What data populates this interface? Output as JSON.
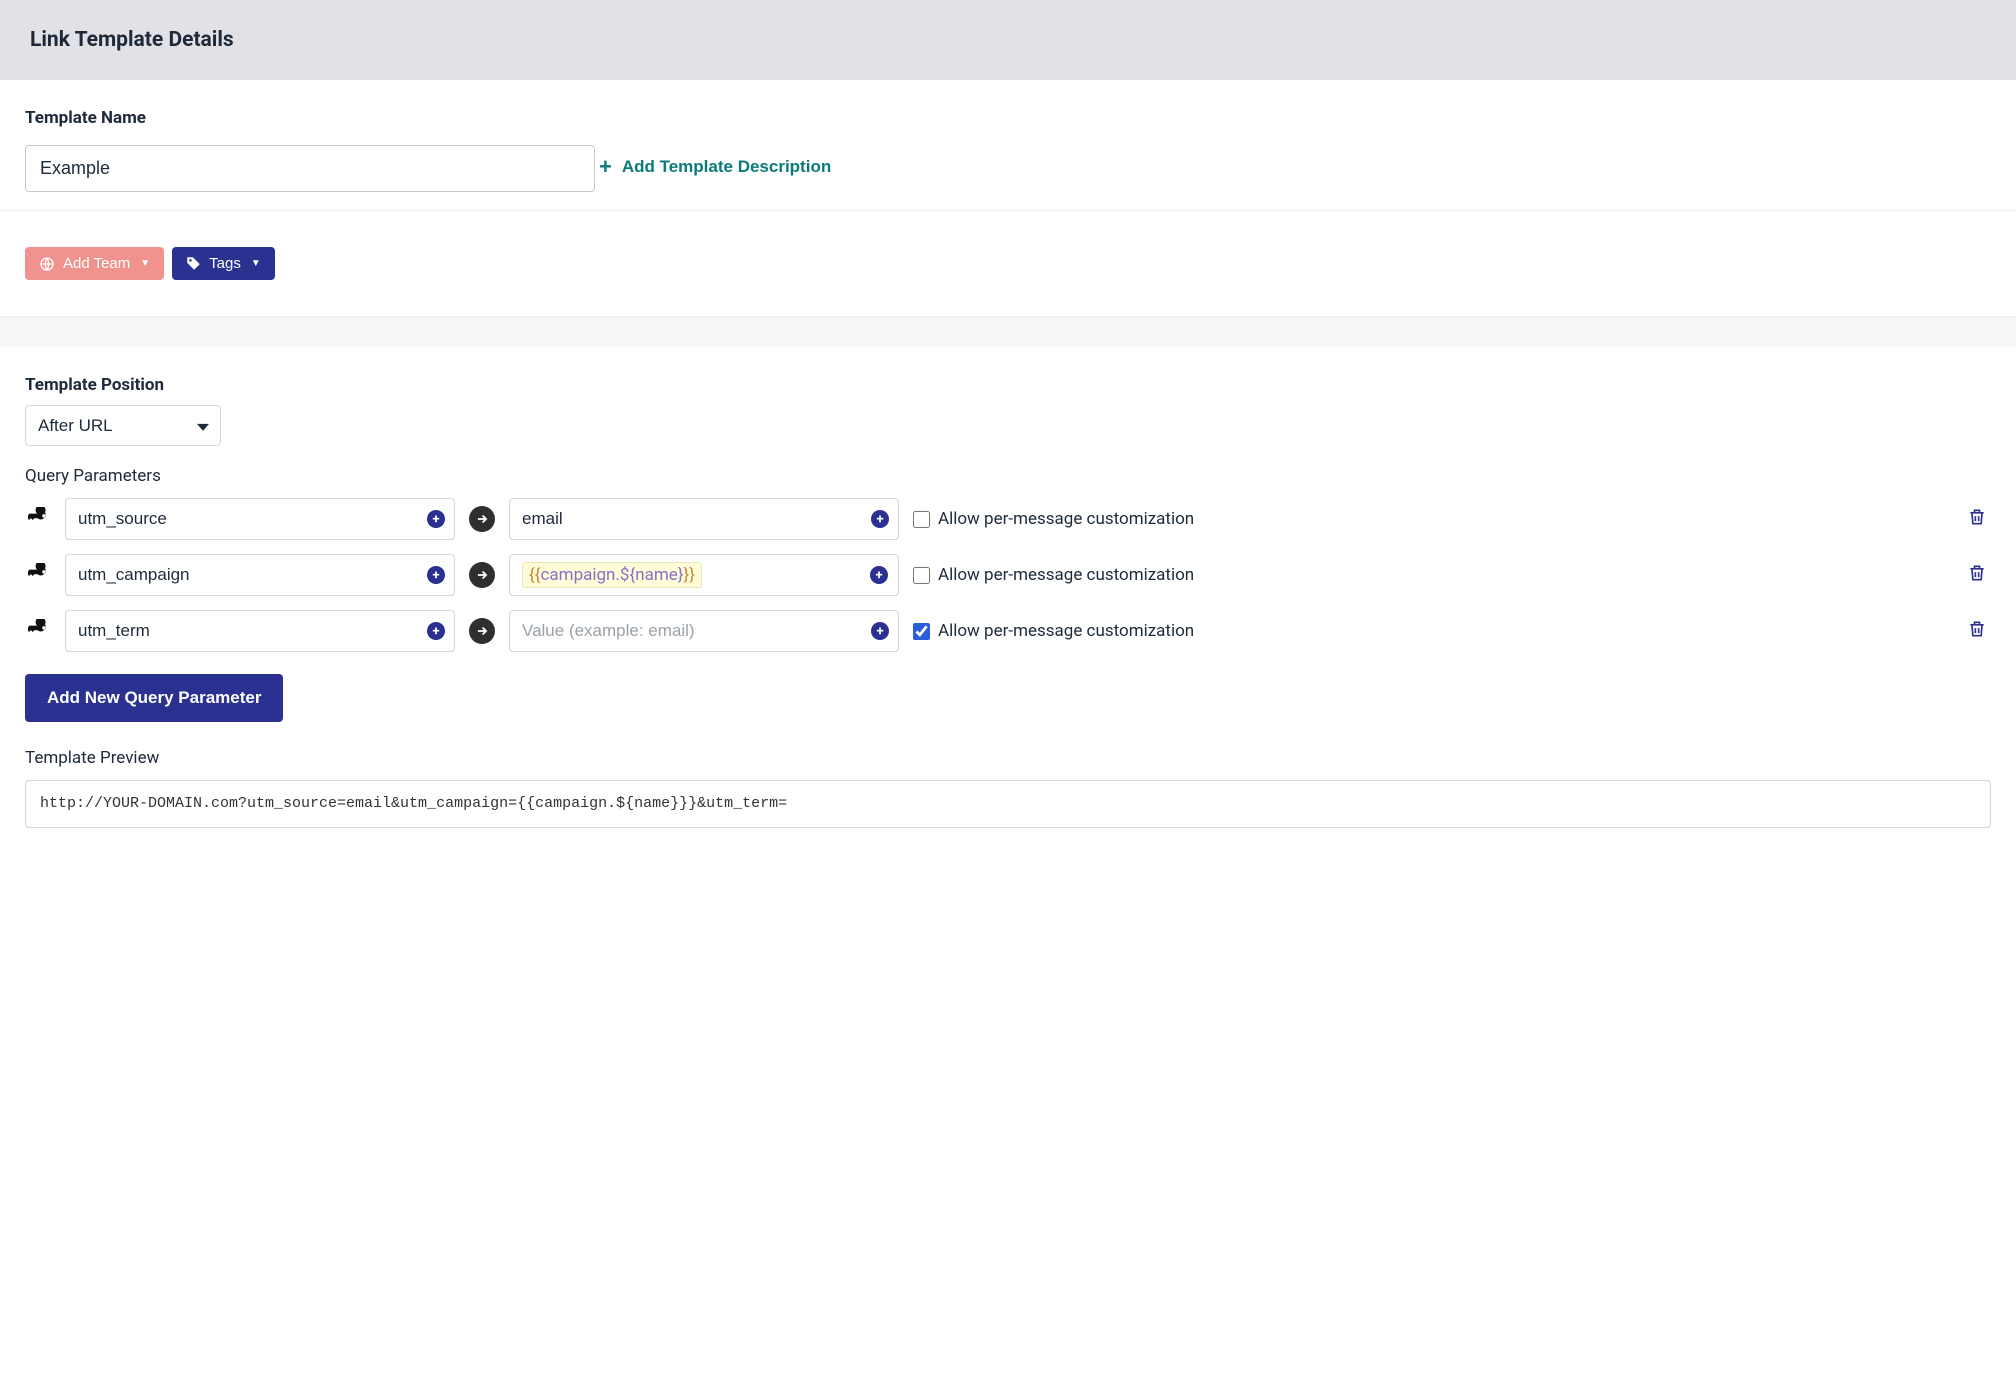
{
  "header": {
    "title": "Link Template Details"
  },
  "templateName": {
    "label": "Template Name",
    "value": "Example"
  },
  "addDescription": {
    "label": "Add Template Description"
  },
  "pills": {
    "addTeam": "Add Team",
    "tags": "Tags"
  },
  "position": {
    "label": "Template Position",
    "selected": "After URL"
  },
  "queryParams": {
    "label": "Query Parameters",
    "valuePlaceholder": "Value (example: email)",
    "allowLabel": "Allow per-message customization",
    "rows": [
      {
        "key": "utm_source",
        "value": "email",
        "allow": false,
        "isLiquid": false
      },
      {
        "key": "utm_campaign",
        "value": "{{campaign.${name}}}",
        "allow": false,
        "isLiquid": true
      },
      {
        "key": "utm_term",
        "value": "",
        "allow": true,
        "isLiquid": false
      }
    ]
  },
  "addParamButton": "Add New Query Parameter",
  "preview": {
    "label": "Template Preview",
    "value": "http://YOUR-DOMAIN.com?utm_source=email&utm_campaign={{campaign.${name}}}&utm_term="
  }
}
